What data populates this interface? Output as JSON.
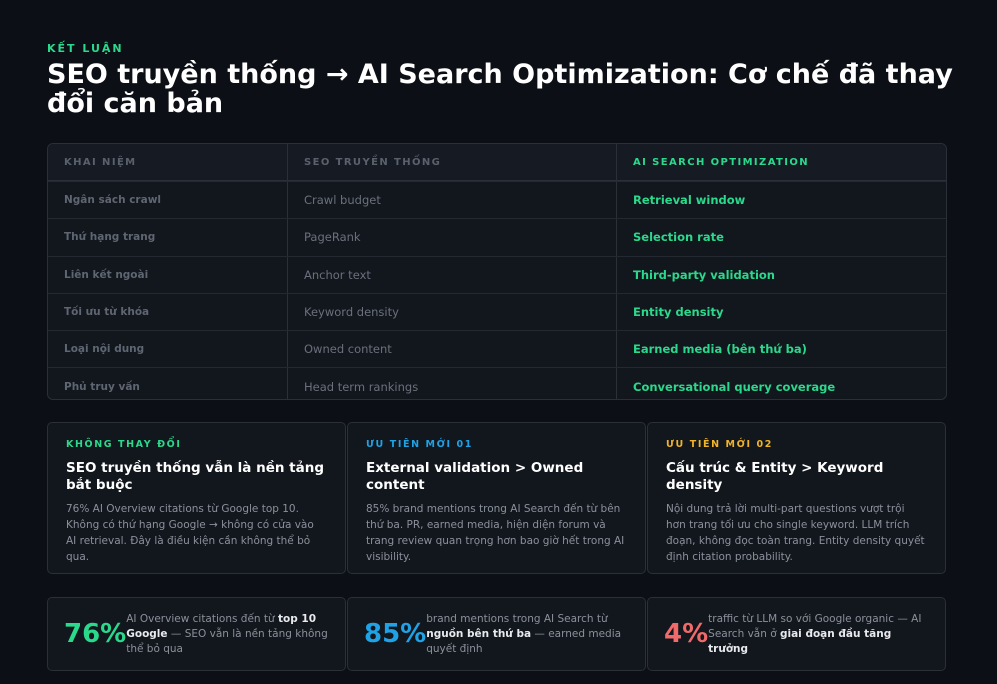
{
  "header": {
    "eyebrow": "KẾT LUẬN",
    "title": "SEO truyền thống → AI Search Optimization: Cơ chế đã thay đổi căn bản"
  },
  "table": {
    "columns": [
      "KHAI NIỆM",
      "SEO TRUYỀN THỐNG",
      "AI SEARCH OPTIMIZATION"
    ],
    "rows": [
      [
        "Ngân sách crawl",
        "Crawl budget",
        "Retrieval window"
      ],
      [
        "Thứ hạng trang",
        "PageRank",
        "Selection rate"
      ],
      [
        "Liên kết ngoài",
        "Anchor text",
        "Third-party validation"
      ],
      [
        "Tối ưu từ khóa",
        "Keyword density",
        "Entity density"
      ],
      [
        "Loại nội dung",
        "Owned content",
        "Earned media (bên thứ ba)"
      ],
      [
        "Phủ truy vấn",
        "Head term rankings",
        "Conversational query coverage"
      ]
    ]
  },
  "cards": [
    {
      "tag": "KHÔNG THAY ĐỔI",
      "title": "SEO truyền thống vẫn là nền tảng bắt buộc",
      "body": "76% AI Overview citations từ Google top 10. Không có thứ hạng Google → không có cửa vào AI retrieval. Đây là điều kiện cần không thể bỏ qua.",
      "color": "#2bd98c"
    },
    {
      "tag": "ƯU TIÊN MỚI 01",
      "title": "External validation > Owned content",
      "body": "85% brand mentions trong AI Search đến từ bên thứ ba. PR, earned media, hiện diện forum và trang review quan trọng hơn bao giờ hết trong AI visibility.",
      "color": "#1fa3e6"
    },
    {
      "tag": "ƯU TIÊN MỚI 02",
      "title": "Cấu trúc & Entity > Keyword density",
      "body": "Nội dung trả lời multi-part questions vượt trội hơn trang tối ưu cho single keyword. LLM trích đoạn, không đọc toàn trang. Entity density quyết định citation probability.",
      "color": "#f0b429"
    }
  ],
  "stats": [
    {
      "value": "76%",
      "color": "#2bd98c",
      "pre": "AI Overview citations đến từ ",
      "bold": "top 10 Google",
      "post": " — SEO vẫn là nền tảng không thể bỏ qua"
    },
    {
      "value": "85%",
      "color": "#1fa3e6",
      "pre": "brand mentions trong AI Search từ ",
      "bold": "nguồn bên thứ ba",
      "post": " — earned media quyết định"
    },
    {
      "value": "4%",
      "color": "#f06a6a",
      "pre": "traffic từ LLM so với Google organic — AI Search vẫn ở ",
      "bold": "giai đoạn đầu tăng trưởng",
      "post": ""
    }
  ]
}
